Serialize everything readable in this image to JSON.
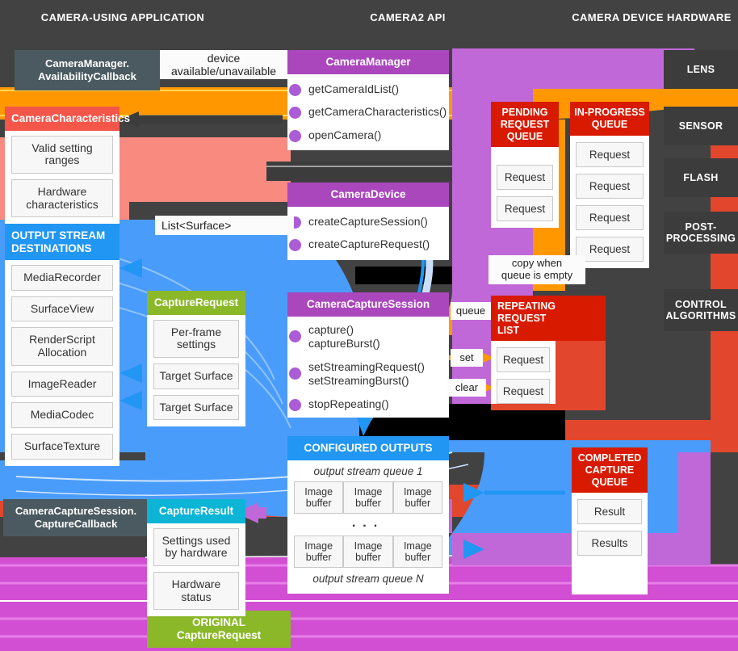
{
  "headers": [
    {
      "label": "CAMERA-USING APPLICATION"
    },
    {
      "label": "CAMERA2 API"
    },
    {
      "label": "CAMERA DEVICE HARDWARE"
    }
  ],
  "callbacks": {
    "availability": "CameraManager.\nAvailabilityCallback",
    "availability_line1": "CameraManager.",
    "availability_line2": "AvailabilityCallback",
    "capture": "CameraCaptureSession.\nCaptureCallback",
    "capture_line1": "CameraCaptureSession.",
    "capture_line2": "CaptureCallback"
  },
  "tags": {
    "device_availability_l1": "device",
    "device_availability_l2": "available/unavailable",
    "list_surface": "List<Surface>",
    "copy_when_l1": "copy when",
    "copy_when_l2": "queue is empty",
    "queue": "queue",
    "set": "set",
    "clear": "clear"
  },
  "cards": {
    "camera_characteristics": {
      "title": "CameraCharacteristics",
      "accent": "#f4564a",
      "items": [
        "Valid setting\nranges",
        "Hardware\ncharacteristics"
      ],
      "items_flat": [
        {
          "l1": "Valid setting",
          "l2": "ranges"
        },
        {
          "l1": "Hardware",
          "l2": "characteristics"
        }
      ]
    },
    "output_stream_destinations": {
      "title": "OUTPUT STREAM\nDESTINATIONS",
      "title_l1": "OUTPUT STREAM",
      "title_l2": "DESTINATIONS",
      "accent": "#2196f3",
      "items": [
        "MediaRecorder",
        "SurfaceView",
        "RenderScript\nAllocation",
        "ImageReader",
        "MediaCodec",
        "SurfaceTexture"
      ],
      "items_flat": [
        {
          "l1": "MediaRecorder",
          "l2": ""
        },
        {
          "l1": "SurfaceView",
          "l2": ""
        },
        {
          "l1": "RenderScript",
          "l2": "Allocation"
        },
        {
          "l1": "ImageReader",
          "l2": ""
        },
        {
          "l1": "MediaCodec",
          "l2": ""
        },
        {
          "l1": "SurfaceTexture",
          "l2": ""
        }
      ]
    },
    "capture_request": {
      "title": "CaptureRequest",
      "accent": "#8bb829",
      "items_flat": [
        {
          "l1": "Per-frame",
          "l2": "settings"
        },
        {
          "l1": "Target Surface",
          "l2": ""
        },
        {
          "l1": "Target Surface",
          "l2": ""
        }
      ]
    },
    "capture_result": {
      "title": "CaptureResult",
      "accent": "#0cb4d6",
      "items_flat": [
        {
          "l1": "Settings used",
          "l2": "by hardware"
        },
        {
          "l1": "Hardware",
          "l2": "status"
        }
      ]
    },
    "original_capture_request": {
      "title_l1": "ORIGINAL",
      "title_l2": "CaptureRequest",
      "accent": "#8bb829"
    },
    "camera_manager": {
      "title": "CameraManager",
      "accent": "#aa47bc",
      "methods": [
        "getCameraIdList()",
        "getCameraCharacteristics()",
        "openCamera()"
      ]
    },
    "camera_device": {
      "title": "CameraDevice",
      "accent": "#aa47bc",
      "methods": [
        "createCaptureSession()",
        "createCaptureRequest()"
      ]
    },
    "camera_capture_session": {
      "title": "CameraCaptureSession",
      "accent": "#aa47bc",
      "methods_flat": [
        {
          "l1": "capture()",
          "l2": "captureBurst()"
        },
        {
          "l1": "setStreamingRequest()",
          "l2": "setStreamingBurst()"
        },
        {
          "l1": "stopRepeating()",
          "l2": ""
        }
      ]
    },
    "configured_outputs": {
      "title": "CONFIGURED OUTPUTS",
      "accent": "#2196f3",
      "stream_first": "output stream queue 1",
      "stream_last": "output stream queue N",
      "buffer_label_l1": "Image",
      "buffer_label_l2": "buffer",
      "buffers_per_row": 3,
      "ellipsis": "..."
    }
  },
  "queues": {
    "pending_request": {
      "title_lines": [
        "PENDING",
        "REQUEST",
        "QUEUE"
      ],
      "accent": "#d81b00",
      "items": [
        "Request",
        "Request"
      ]
    },
    "in_progress": {
      "title_lines": [
        "IN-PROGRESS",
        "QUEUE"
      ],
      "accent": "#d81b00",
      "items": [
        "Request",
        "Request",
        "Request",
        "Request"
      ]
    },
    "repeating_request_list": {
      "title_lines": [
        "REPEATING",
        "REQUEST",
        "LIST"
      ],
      "accent": "#d81b00",
      "items": [
        "Request",
        "Request"
      ]
    },
    "completed_capture": {
      "title_lines": [
        "COMPLETED",
        "CAPTURE",
        "QUEUE"
      ],
      "accent": "#d81b00",
      "items": [
        "Result",
        "Results"
      ]
    }
  },
  "hardware": [
    {
      "label": "LENS",
      "lines": [
        "LENS"
      ]
    },
    {
      "label": "SENSOR",
      "lines": [
        "SENSOR"
      ]
    },
    {
      "label": "FLASH",
      "lines": [
        "FLASH"
      ]
    },
    {
      "label": "POST-PROCESSING",
      "lines": [
        "POST-",
        "PROCESSING"
      ]
    },
    {
      "label": "CONTROL ALGORITHMS",
      "lines": [
        "CONTROL",
        "ALGORITHMS"
      ]
    }
  ],
  "colors": {
    "background": "#424242",
    "orange": "#ff9800",
    "red": "#e2462d",
    "blue": "#4a9cfb",
    "purple": "#c168d8",
    "magenta": "#d24fd4",
    "green": "#8bb829",
    "cyan": "#0cb4d6",
    "dark_gray": "#4a5a60",
    "salmon": "#f98a80"
  }
}
